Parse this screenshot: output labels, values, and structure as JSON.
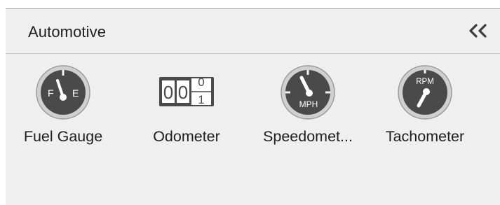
{
  "panel": {
    "title": "Automotive",
    "collapse_icon": "double-chevron-left-icon"
  },
  "items": [
    {
      "label": "Fuel Gauge",
      "icon": "fuel-gauge-icon",
      "icon_text": [
        "F",
        "E"
      ]
    },
    {
      "label": "Odometer",
      "icon": "odometer-icon",
      "icon_text": [
        "0",
        "0",
        "0",
        "1"
      ]
    },
    {
      "label": "Speedomet...",
      "icon": "speedometer-icon",
      "icon_text": [
        "MPH"
      ]
    },
    {
      "label": "Tachometer",
      "icon": "tachometer-icon",
      "icon_text": [
        "RPM"
      ]
    }
  ],
  "colors": {
    "panel_bg": "#efefef",
    "gauge_dark": "#4a4a4a",
    "gauge_rim": "#c7c7c7",
    "text": "#1e1e1e"
  }
}
